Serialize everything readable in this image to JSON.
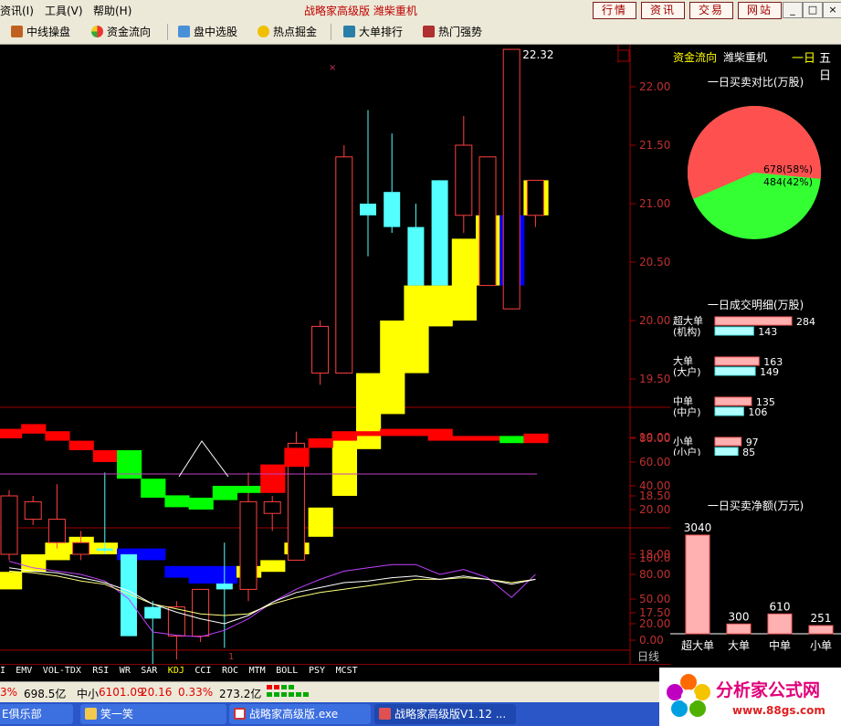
{
  "menu": {
    "items": [
      "资讯(I)",
      "工具(V)",
      "帮助(H)"
    ]
  },
  "app_title": "战略家高级版  潍柴重机",
  "ext_buttons": [
    "行情",
    "资讯",
    "交易",
    "网站"
  ],
  "window_buttons": [
    "_",
    "□",
    "×"
  ],
  "toolbar": {
    "items": [
      "中线操盘",
      "资金流向",
      "盘中选股",
      "热点掘金",
      "大单排行",
      "热门强势"
    ]
  },
  "price_chart": {
    "y_ticks": [
      "22.00",
      "21.50",
      "21.00",
      "20.50",
      "20.00",
      "19.50",
      "19.00",
      "18.50",
      "18.00",
      "17.50",
      "17.00"
    ],
    "high_label": "22.32",
    "candles": [
      {
        "o": 18.0,
        "c": 18.5,
        "h": 18.55,
        "l": 17.95
      },
      {
        "o": 18.3,
        "c": 18.45,
        "h": 18.5,
        "l": 18.25
      },
      {
        "o": 18.1,
        "c": 18.3,
        "h": 18.6,
        "l": 18.05
      },
      {
        "o": 18.0,
        "c": 18.1,
        "h": 18.2,
        "l": 17.95
      },
      {
        "o": 18.05,
        "c": 18.03,
        "h": 18.7,
        "l": 18.0
      },
      {
        "o": 18.0,
        "c": 17.3,
        "h": 18.0,
        "l": 17.3
      },
      {
        "o": 17.55,
        "c": 17.45,
        "h": 17.6,
        "l": 17.0
      },
      {
        "o": 17.3,
        "c": 17.55,
        "h": 17.6,
        "l": 17.1
      },
      {
        "o": 17.3,
        "c": 17.7,
        "h": 17.7,
        "l": 17.25
      },
      {
        "o": 17.75,
        "c": 17.7,
        "h": 18.1,
        "l": 17.2
      },
      {
        "o": 17.7,
        "c": 18.45,
        "h": 18.7,
        "l": 17.6
      },
      {
        "o": 18.35,
        "c": 18.45,
        "h": 18.5,
        "l": 18.2
      },
      {
        "o": 17.95,
        "c": 18.95,
        "h": 19.05,
        "l": 17.95
      },
      {
        "o": 19.55,
        "c": 19.95,
        "h": 20.0,
        "l": 19.45
      },
      {
        "o": 19.55,
        "c": 21.4,
        "h": 21.5,
        "l": 19.55
      },
      {
        "o": 21.0,
        "c": 20.9,
        "h": 21.8,
        "l": 20.55
      },
      {
        "o": 21.1,
        "c": 20.8,
        "h": 21.6,
        "l": 20.75
      },
      {
        "o": 20.8,
        "c": 20.3,
        "h": 21.0,
        "l": 20.3
      },
      {
        "o": 21.2,
        "c": 20.3,
        "h": 21.2,
        "l": 20.3
      },
      {
        "o": 20.9,
        "c": 21.5,
        "h": 21.75,
        "l": 20.75
      },
      {
        "o": 20.3,
        "c": 21.4,
        "h": 21.4,
        "l": 20.3
      },
      {
        "o": 20.1,
        "c": 22.32,
        "h": 22.32,
        "l": 20.1
      },
      {
        "o": 20.9,
        "c": 21.2,
        "h": 21.2,
        "l": 20.8
      }
    ],
    "band": [
      {
        "bot": 17.7,
        "top": 17.85,
        "c": "#ffff00"
      },
      {
        "bot": 17.85,
        "top": 18.0,
        "c": "#ffff00"
      },
      {
        "bot": 17.95,
        "top": 18.1,
        "c": "#ffff00"
      },
      {
        "bot": 18.0,
        "top": 18.15,
        "c": "#ffff00"
      },
      {
        "bot": 18.0,
        "top": 18.1,
        "c": "#ffff00"
      },
      {
        "bot": 17.95,
        "top": 18.05,
        "c": "#0000ff"
      },
      {
        "bot": 17.95,
        "top": 18.05,
        "c": "#0000ff"
      },
      {
        "bot": 17.8,
        "top": 17.9,
        "c": "#0000ff"
      },
      {
        "bot": 17.75,
        "top": 17.9,
        "c": "#0000ff"
      },
      {
        "bot": 17.75,
        "top": 17.9,
        "c": "#0000ff"
      },
      {
        "bot": 17.8,
        "top": 17.9,
        "c": "#ffff00"
      },
      {
        "bot": 17.85,
        "top": 17.95,
        "c": "#ffff00"
      },
      {
        "bot": 18.0,
        "top": 18.1,
        "c": "#ffff00"
      },
      {
        "bot": 18.15,
        "top": 18.4,
        "c": "#ffff00"
      },
      {
        "bot": 18.5,
        "top": 19.05,
        "c": "#ffff00"
      },
      {
        "bot": 18.9,
        "top": 19.55,
        "c": "#ffff00"
      },
      {
        "bot": 19.2,
        "top": 20.0,
        "c": "#ffff00"
      },
      {
        "bot": 19.55,
        "top": 20.3,
        "c": "#ffff00"
      },
      {
        "bot": 19.95,
        "top": 20.3,
        "c": "#ffff00"
      },
      {
        "bot": 20.0,
        "top": 20.7,
        "c": "#ffff00"
      },
      {
        "bot": 20.3,
        "top": 20.9,
        "c": "#ffff00"
      },
      {
        "bot": 20.3,
        "top": 20.9,
        "c": "#0000ff"
      },
      {
        "bot": 20.9,
        "top": 21.2,
        "c": "#ffff00"
      }
    ]
  },
  "indicator1": {
    "y_ticks": [
      "80.00",
      "60.00",
      "40.00",
      "20.00"
    ],
    "blocks": [
      {
        "v": [
          80,
          88
        ],
        "c": "#ff0000"
      },
      {
        "v": [
          84,
          92
        ],
        "c": "#ff0000"
      },
      {
        "v": [
          78,
          86
        ],
        "c": "#ff0000"
      },
      {
        "v": [
          70,
          78
        ],
        "c": "#ff0000"
      },
      {
        "v": [
          60,
          70
        ],
        "c": "#ff0000"
      },
      {
        "v": [
          46,
          70
        ],
        "c": "#00ff00"
      },
      {
        "v": [
          30,
          46
        ],
        "c": "#00ff00"
      },
      {
        "v": [
          22,
          32
        ],
        "c": "#00ff00"
      },
      {
        "v": [
          20,
          30
        ],
        "c": "#00ff00"
      },
      {
        "v": [
          28,
          40
        ],
        "c": "#00ff00"
      },
      {
        "v": [
          34,
          40
        ],
        "c": "#00ff00"
      },
      {
        "v": [
          34,
          58
        ],
        "c": "#ff0000"
      },
      {
        "v": [
          56,
          72
        ],
        "c": "#ff0000"
      },
      {
        "v": [
          72,
          80
        ],
        "c": "#ff0000"
      },
      {
        "v": [
          78,
          86
        ],
        "c": "#ff0000"
      },
      {
        "v": [
          82,
          86
        ],
        "c": "#ff0000"
      },
      {
        "v": [
          82,
          88
        ],
        "c": "#ff0000"
      },
      {
        "v": [
          82,
          88
        ],
        "c": "#ff0000"
      },
      {
        "v": [
          78,
          88
        ],
        "c": "#ff0000"
      },
      {
        "v": [
          78,
          82
        ],
        "c": "#ff0000"
      },
      {
        "v": [
          78,
          82
        ],
        "c": "#ff0000"
      },
      {
        "v": [
          76,
          82
        ],
        "c": "#00ff00"
      },
      {
        "v": [
          76,
          84
        ],
        "c": "#ff0000"
      }
    ],
    "line_level": 50
  },
  "indicator2": {
    "y_ticks": [
      "100.00",
      "80.00",
      "50.00",
      "20.00",
      "0.00"
    ],
    "k": [
      88,
      84,
      82,
      76,
      70,
      60,
      44,
      34,
      26,
      20,
      30,
      46,
      58,
      64,
      70,
      72,
      76,
      78,
      74,
      78,
      74,
      68,
      74
    ],
    "d": [
      84,
      82,
      78,
      72,
      68,
      56,
      44,
      38,
      32,
      30,
      32,
      44,
      52,
      58,
      62,
      66,
      70,
      74,
      74,
      76,
      74,
      70,
      74
    ],
    "j": [
      96,
      88,
      84,
      80,
      72,
      50,
      10,
      6,
      4,
      12,
      26,
      46,
      62,
      74,
      84,
      88,
      92,
      92,
      80,
      86,
      76,
      52,
      80
    ]
  },
  "tabs": [
    "I",
    "EMV",
    "VOL-TDX",
    "RSI",
    "WR",
    "SAR",
    "KDJ",
    "CCI",
    "ROC",
    "MTM",
    "BOLL",
    "PSY",
    "MCST"
  ],
  "period_label": "日线",
  "x_marker": "1",
  "right_panel": {
    "tab_active": "资金流向",
    "stock_name": "潍柴重机",
    "period_tabs": [
      "一日",
      "五日"
    ],
    "pie": {
      "title": "一日买卖对比(万股)",
      "buy_label": "678(58%)",
      "sell_label": "484(42%)",
      "buy_pct": 58,
      "colors": {
        "buy": "#ff5050",
        "sell": "#33ff33"
      }
    },
    "detail": {
      "title": "一日成交明细(万股)",
      "rows": [
        {
          "name": "超大单",
          "sub": "(机构)",
          "buy": 284,
          "sell": 143
        },
        {
          "name": "大单",
          "sub": "(大户)",
          "buy": 163,
          "sell": 149
        },
        {
          "name": "中单",
          "sub": "(中户)",
          "buy": 135,
          "sell": 106
        },
        {
          "name": "小单",
          "sub": "(小户)",
          "buy": 97,
          "sell": 85
        }
      ]
    },
    "net": {
      "title": "一日买卖净额(万元)",
      "bars": [
        {
          "label": "超大单",
          "value": 3040
        },
        {
          "label": "大单",
          "value": 300
        },
        {
          "label": "中单",
          "value": 610
        },
        {
          "label": "小单",
          "value": 251
        }
      ]
    }
  },
  "status": {
    "items": [
      "3%",
      "698.5亿",
      "中小",
      "6101.09",
      "20.16",
      "0.33%",
      "273.2亿"
    ]
  },
  "taskbar": {
    "items": [
      "E俱乐部",
      "笑一笑",
      "战略家高级版.exe",
      "战略家高级版V1.12 ..."
    ]
  },
  "logo": {
    "text": "分析家公式网",
    "url": "www.88gs.com"
  }
}
